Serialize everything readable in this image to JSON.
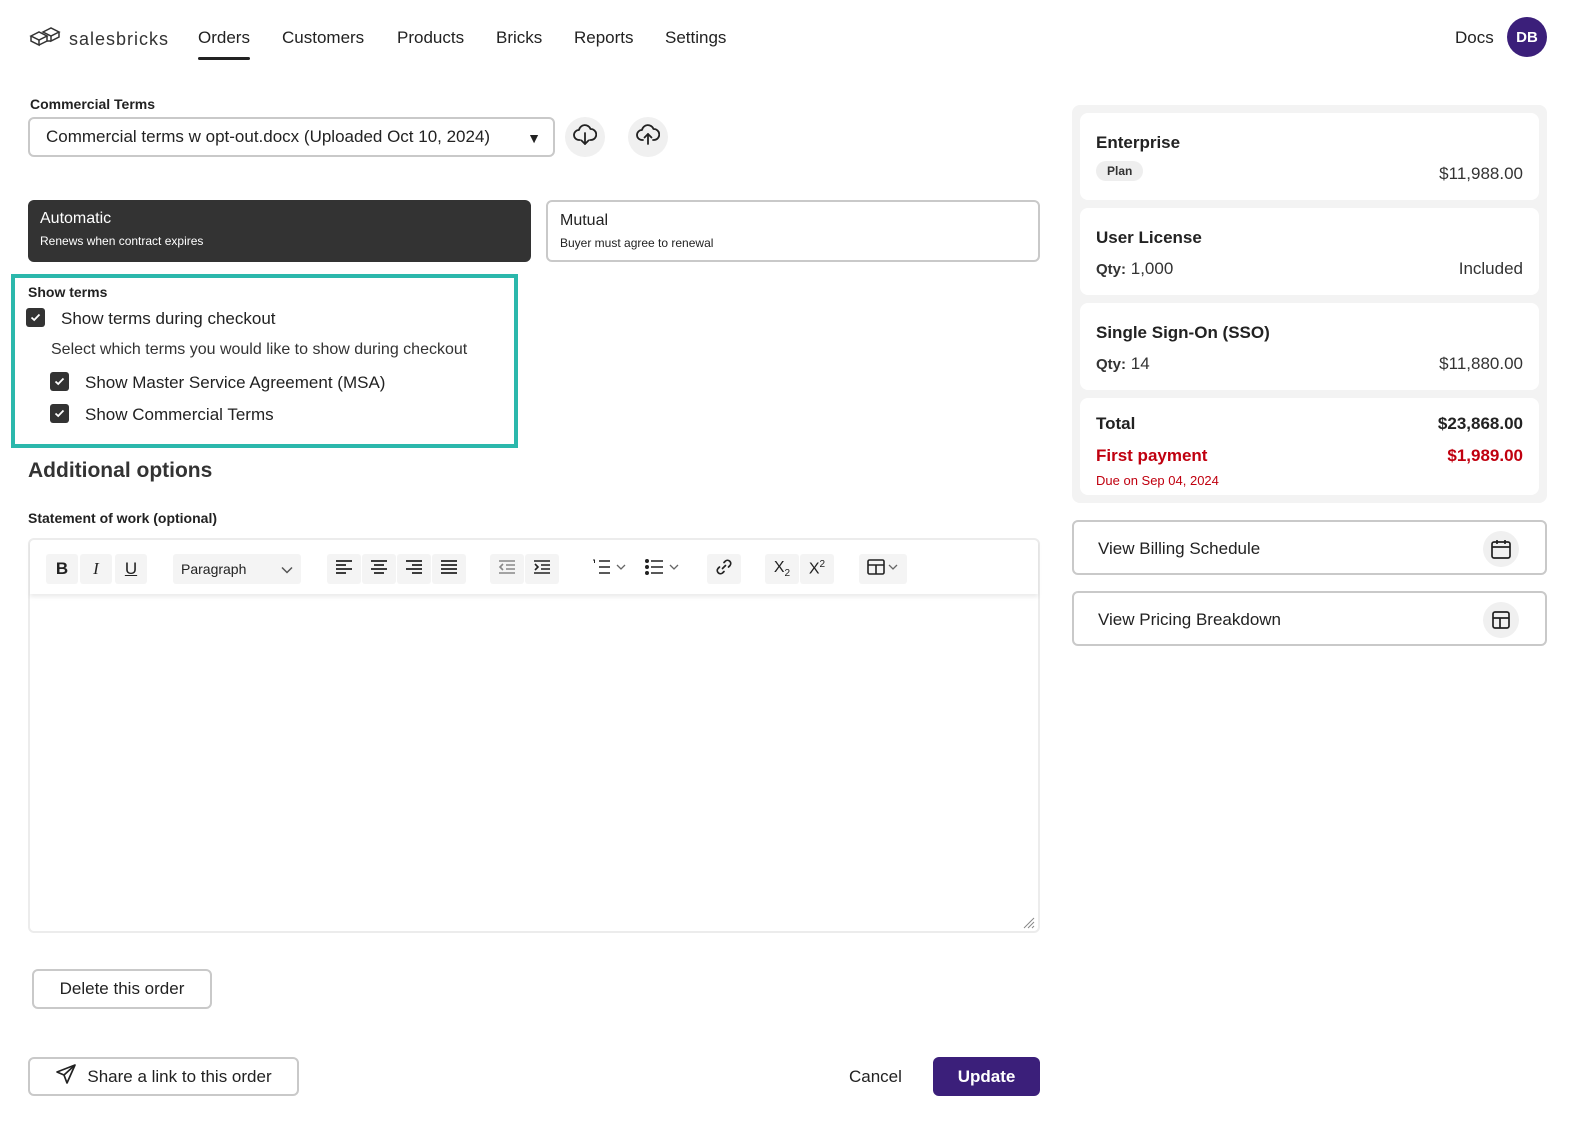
{
  "nav": {
    "logo": "salesbricks",
    "items": [
      "Orders",
      "Customers",
      "Products",
      "Bricks",
      "Reports",
      "Settings"
    ],
    "active": "Orders",
    "docs": "Docs",
    "avatar": "DB"
  },
  "commercial_terms": {
    "label": "Commercial Terms",
    "selected": "Commercial terms w opt-out.docx (Uploaded Oct 10, 2024)",
    "download_icon": "cloud-download-icon",
    "upload_icon": "cloud-upload-icon"
  },
  "renewal": {
    "automatic": {
      "title": "Automatic",
      "subtitle": "Renews when contract expires",
      "selected": true
    },
    "mutual": {
      "title": "Mutual",
      "subtitle": "Buyer must agree to renewal",
      "selected": false
    }
  },
  "show_terms": {
    "title": "Show terms",
    "checkout_label": "Show terms during checkout",
    "checkout_checked": true,
    "hint": "Select which terms you would like to show during checkout",
    "msa_label": "Show Master Service Agreement (MSA)",
    "msa_checked": true,
    "ct_label": "Show Commercial Terms",
    "ct_checked": true,
    "highlight_color": "#2bb8ac"
  },
  "additional": {
    "title": "Additional options",
    "sow_label": "Statement of work (optional)",
    "paragraph_select": "Paragraph",
    "body": ""
  },
  "actions": {
    "delete": "Delete this order",
    "share": "Share a link to this order",
    "cancel": "Cancel",
    "update": "Update"
  },
  "summary": {
    "plan": {
      "name": "Enterprise",
      "badge": "Plan",
      "price": "$11,988.00"
    },
    "user_license": {
      "name": "User License",
      "qty_label": "Qty:",
      "qty": "1,000",
      "price": "Included"
    },
    "sso": {
      "name": "Single Sign-On (SSO)",
      "qty_label": "Qty:",
      "qty": "14",
      "price": "$11,880.00"
    },
    "total_label": "Total",
    "total": "$23,868.00",
    "first_payment_label": "First payment",
    "first_payment": "$1,989.00",
    "due": "Due on Sep 04, 2024",
    "view_billing": "View Billing Schedule",
    "view_pricing": "View Pricing Breakdown"
  },
  "colors": {
    "brand": "#3b1f7a",
    "dark": "#333333",
    "accent_red": "#c0000f",
    "highlight": "#2bb8ac"
  }
}
